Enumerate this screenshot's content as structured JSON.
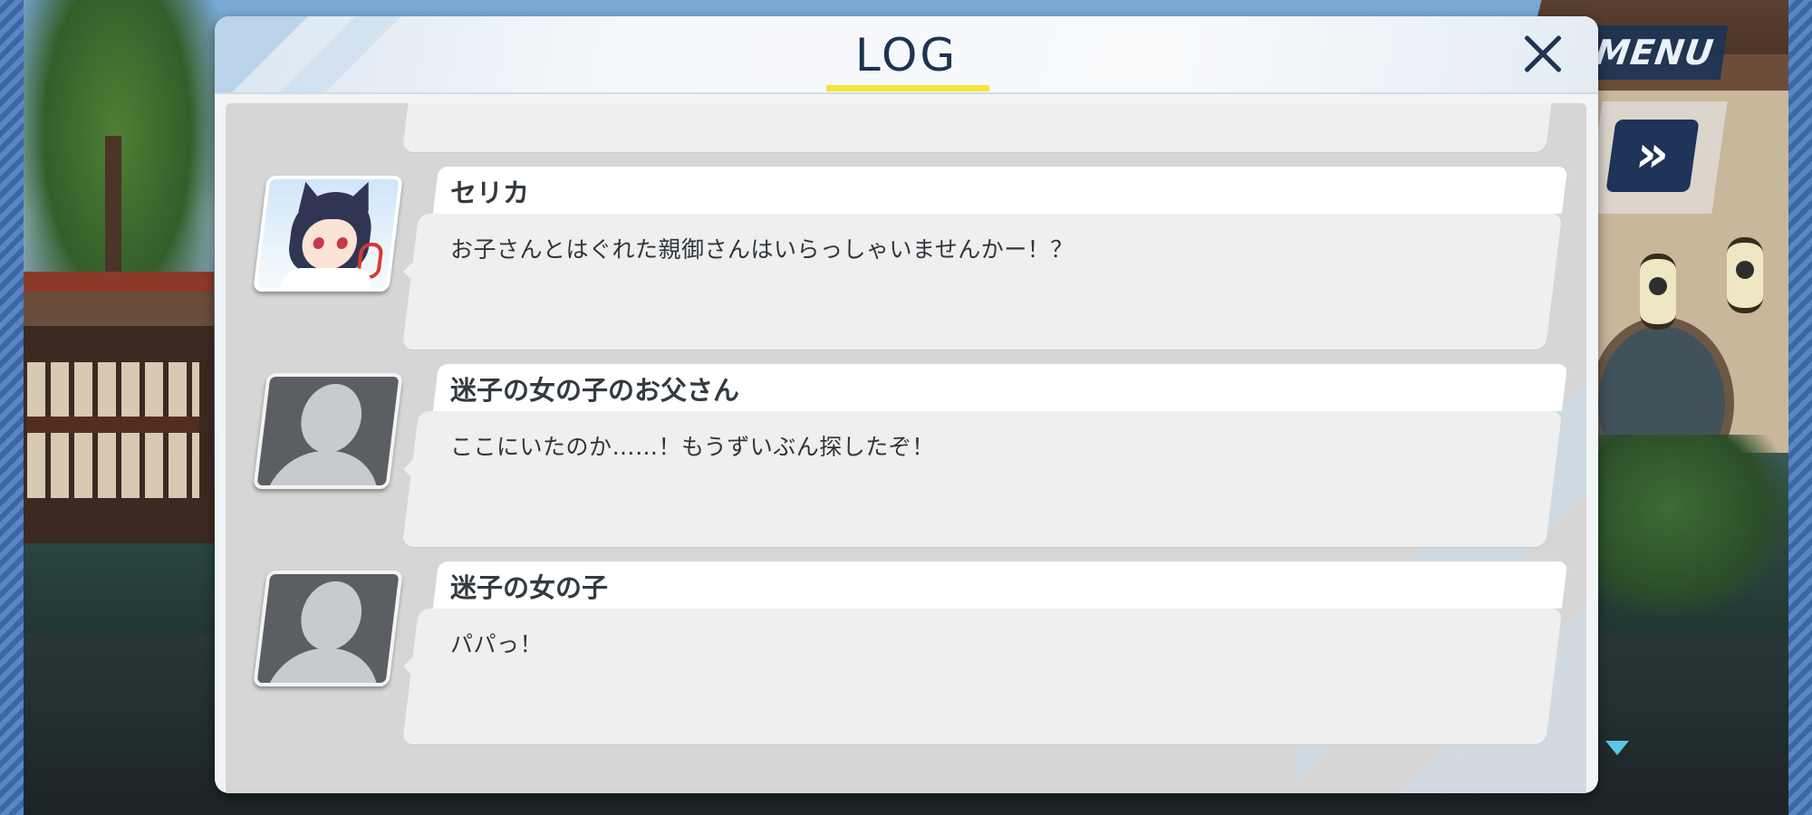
{
  "hud": {
    "menu_label": "MENU",
    "fast_forward_glyph": "»"
  },
  "log_modal": {
    "title": "LOG",
    "entries": [
      {
        "speaker": "",
        "text": "",
        "avatar": "portrait-partial"
      },
      {
        "speaker": "セリカ",
        "text": "お子さんとはぐれた親御さんはいらっしゃいませんかー！？",
        "avatar": "serika-portrait"
      },
      {
        "speaker": "迷子の女の子のお父さん",
        "text": "ここにいたのか……！もうずいぶん探したぞ！",
        "avatar": "silhouette"
      },
      {
        "speaker": "迷子の女の子",
        "text": "パパっ！",
        "avatar": "silhouette"
      }
    ]
  },
  "colors": {
    "title_text": "#1f3352",
    "title_underline": "#f4e43b",
    "list_background": "#d6d6d6",
    "bubble": "#efefef",
    "menu_button": "#1c3456"
  }
}
